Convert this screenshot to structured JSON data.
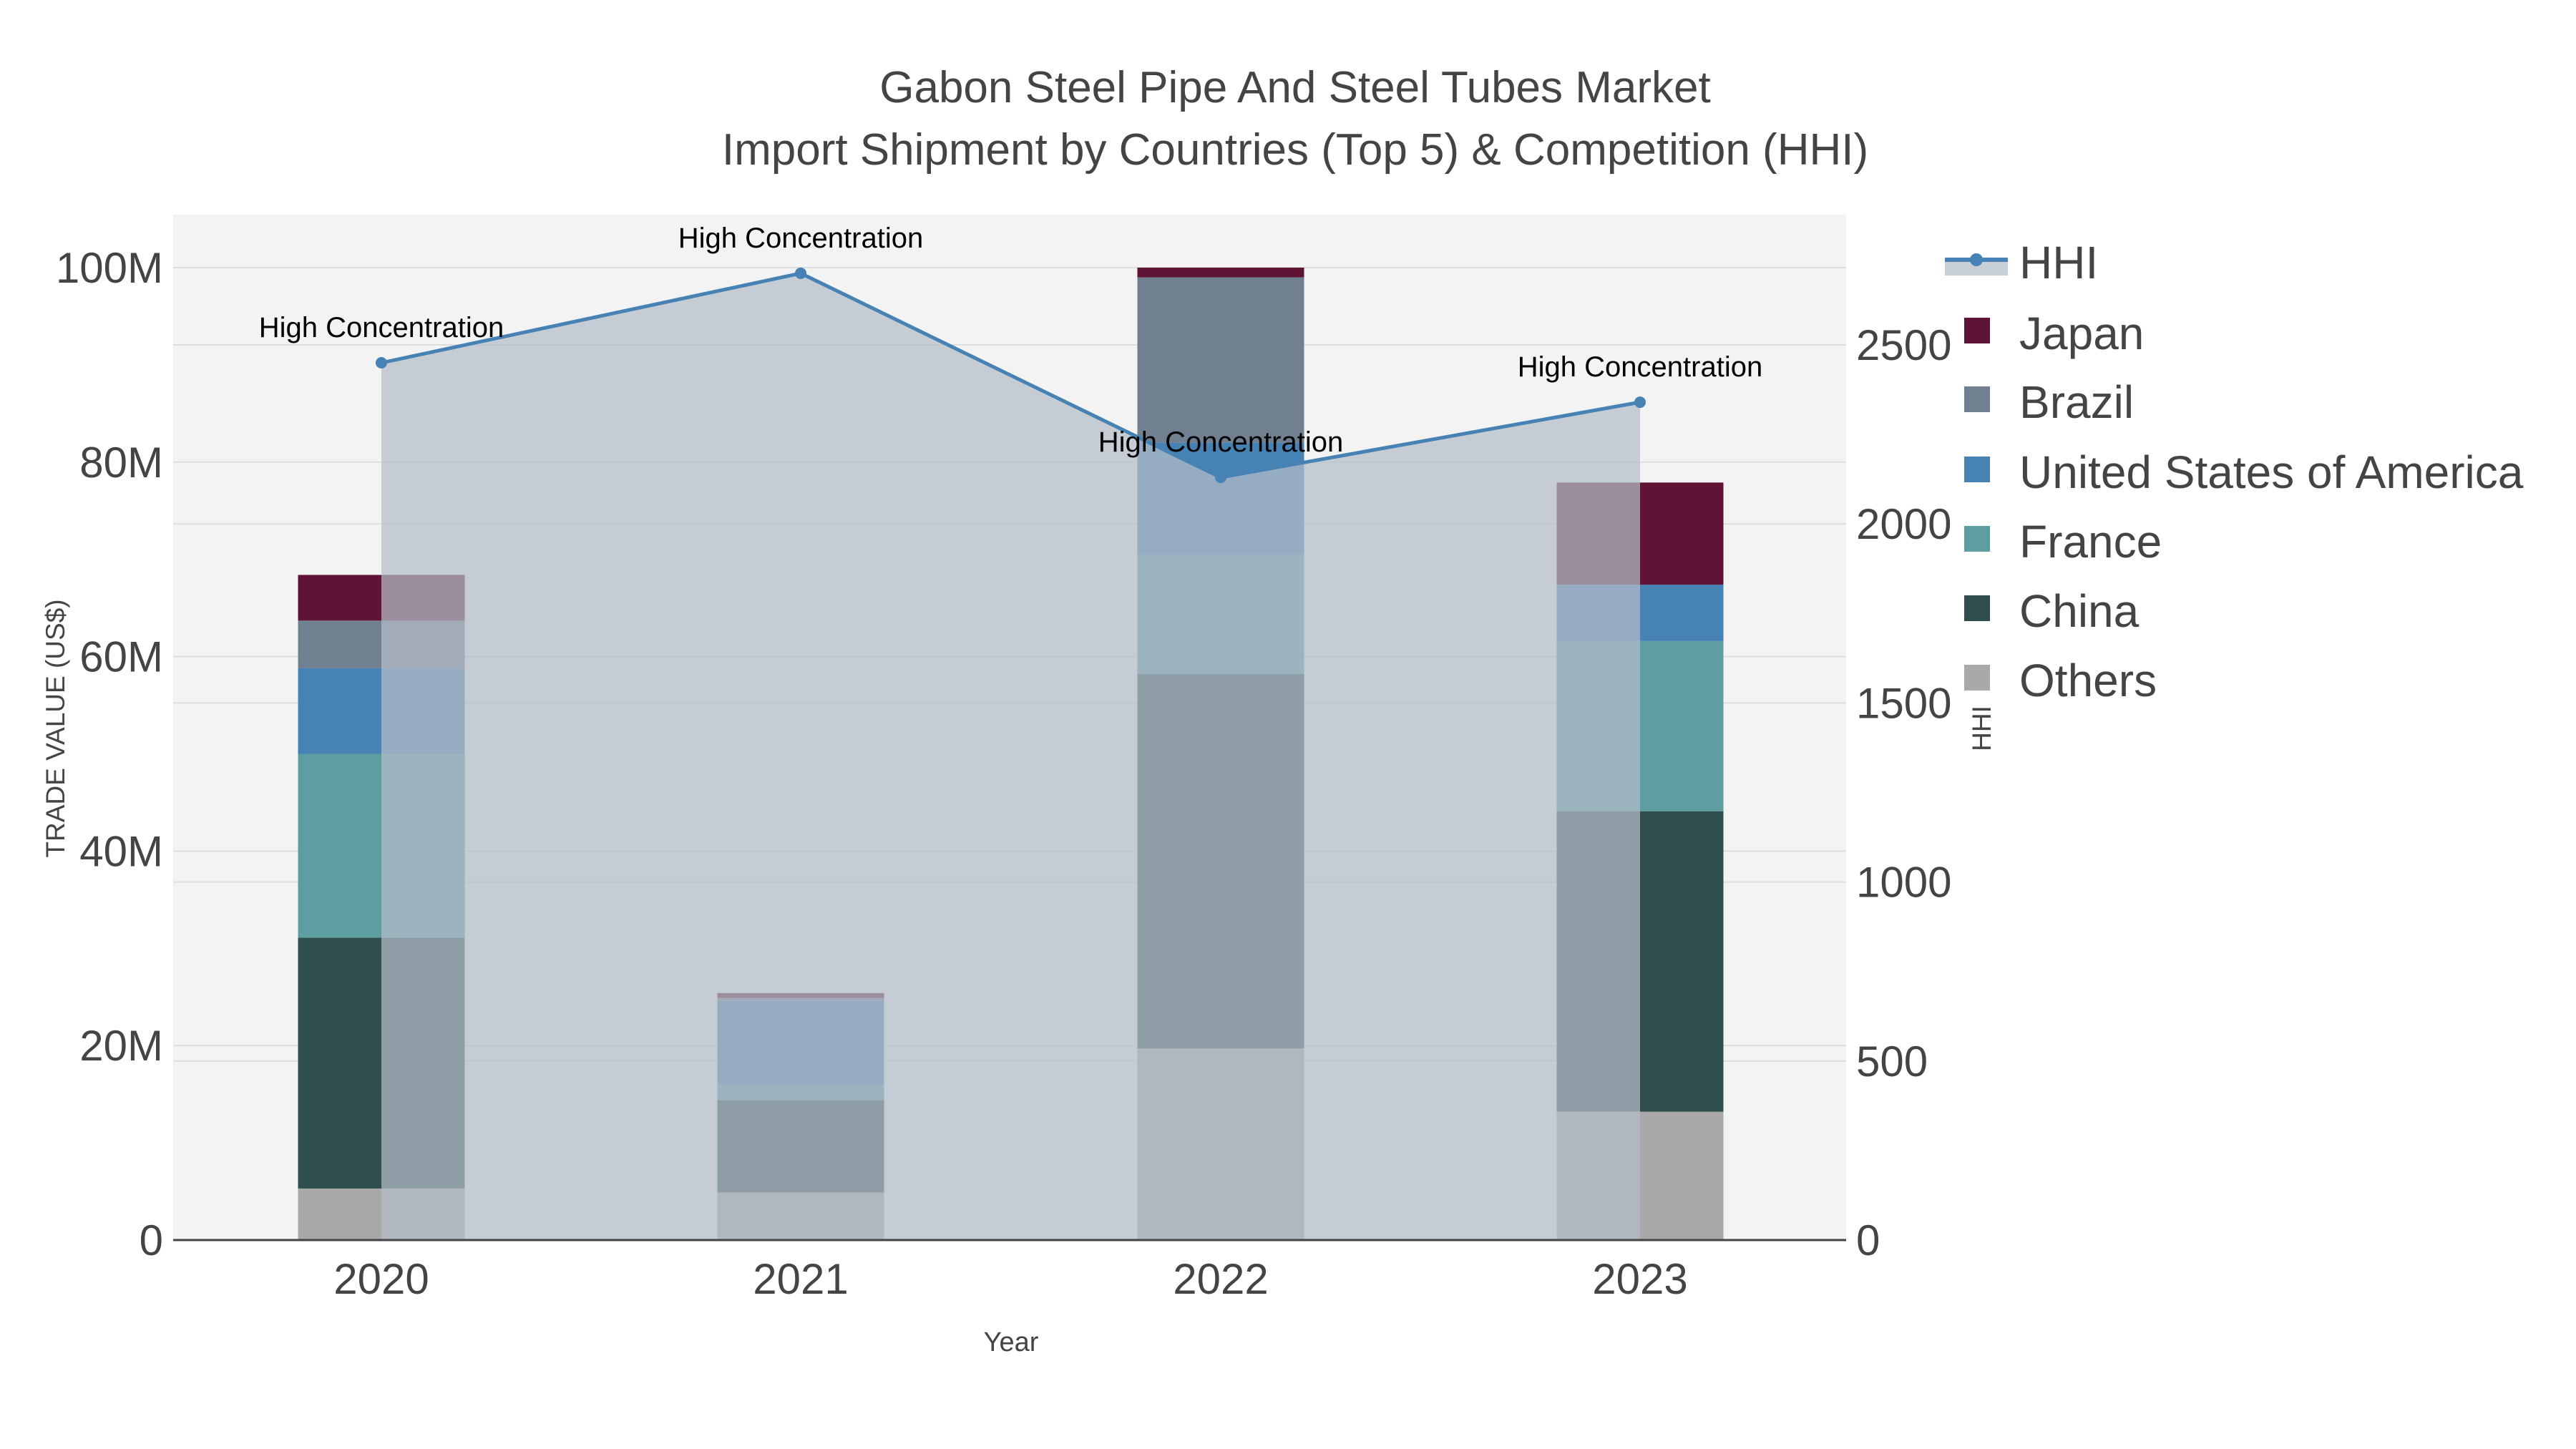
{
  "chart_data": {
    "type": "bar",
    "title_line1": "Gabon Steel Pipe And Steel Tubes Market",
    "title_line2": "Import Shipment by Countries (Top 5) & Competition (HHI)",
    "xlabel": "Year",
    "ylabel": "TRADE VALUE (US$)",
    "y2label": "HHI",
    "categories": [
      "2020",
      "2021",
      "2022",
      "2023"
    ],
    "ylim": [
      0,
      105
    ],
    "y_ticks": [
      0,
      20,
      40,
      60,
      80,
      100
    ],
    "y_tick_labels": [
      "0",
      "20M",
      "40M",
      "60M",
      "80M",
      "100M"
    ],
    "y2lim": [
      0,
      285
    ],
    "y2_ticks": [
      0,
      50,
      100,
      150,
      200,
      250
    ],
    "y2_tick_labels": [
      "0",
      "500",
      "1000",
      "1500",
      "2000",
      "2500"
    ],
    "units": "million US$",
    "series": [
      {
        "name": "Others",
        "color": "#a9a9a9",
        "values": [
          5.3,
          4.9,
          19.7,
          13.2
        ]
      },
      {
        "name": "China",
        "color": "#2f4f4f",
        "values": [
          25.8,
          9.5,
          38.5,
          30.9
        ]
      },
      {
        "name": "France",
        "color": "#5f9ea0",
        "values": [
          18.9,
          1.6,
          12.3,
          17.5
        ]
      },
      {
        "name": "United States of America",
        "color": "#4682b4",
        "values": [
          8.8,
          8.6,
          11.5,
          5.8
        ]
      },
      {
        "name": "Brazil",
        "color": "#708090",
        "values": [
          4.9,
          0.3,
          17.0,
          0.0
        ]
      },
      {
        "name": "Japan",
        "color": "#5f1436",
        "values": [
          4.7,
          0.5,
          1.0,
          10.5
        ]
      }
    ],
    "hhi": {
      "name": "HHI",
      "color": "#4682b4",
      "values": [
        2450,
        2700,
        2130,
        2340
      ],
      "annotations": [
        "High Concentration",
        "High Concentration",
        "High Concentration",
        "High Concentration"
      ]
    },
    "legend_order": [
      "HHI",
      "Japan",
      "Brazil",
      "United States of America",
      "France",
      "China",
      "Others"
    ],
    "legend_position": "right",
    "grid": true
  }
}
